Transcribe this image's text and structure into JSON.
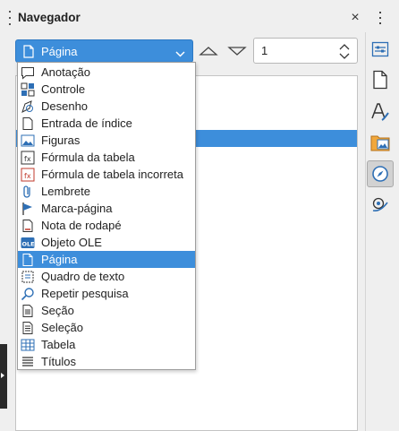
{
  "panel": {
    "title": "Navegador",
    "close_glyph": "×"
  },
  "toolbar": {
    "navigate_by": "Página",
    "page_number": "1"
  },
  "dropdown": {
    "items": [
      {
        "label": "Anotação",
        "icon": "comment-icon"
      },
      {
        "label": "Controle",
        "icon": "control-icon"
      },
      {
        "label": "Desenho",
        "icon": "drawing-icon"
      },
      {
        "label": "Entrada de índice",
        "icon": "index-entry-icon"
      },
      {
        "label": "Figuras",
        "icon": "image-icon"
      },
      {
        "label": "Fórmula da tabela",
        "icon": "table-formula-icon"
      },
      {
        "label": "Fórmula de tabela incorreta",
        "icon": "table-formula-error-icon"
      },
      {
        "label": "Lembrete",
        "icon": "reminder-icon"
      },
      {
        "label": "Marca-página",
        "icon": "bookmark-icon"
      },
      {
        "label": "Nota de rodapé",
        "icon": "footnote-icon"
      },
      {
        "label": "Objeto OLE",
        "icon": "ole-object-icon"
      },
      {
        "label": "Página",
        "icon": "page-icon",
        "selected": true
      },
      {
        "label": "Quadro de texto",
        "icon": "text-frame-icon"
      },
      {
        "label": "Repetir pesquisa",
        "icon": "search-icon"
      },
      {
        "label": "Seção",
        "icon": "section-icon"
      },
      {
        "label": "Seleção",
        "icon": "selection-icon"
      },
      {
        "label": "Tabela",
        "icon": "table-icon"
      },
      {
        "label": "Títulos",
        "icon": "headings-icon"
      }
    ]
  },
  "colors": {
    "accent": "#3d8edb",
    "panel_bg": "#efefef"
  }
}
